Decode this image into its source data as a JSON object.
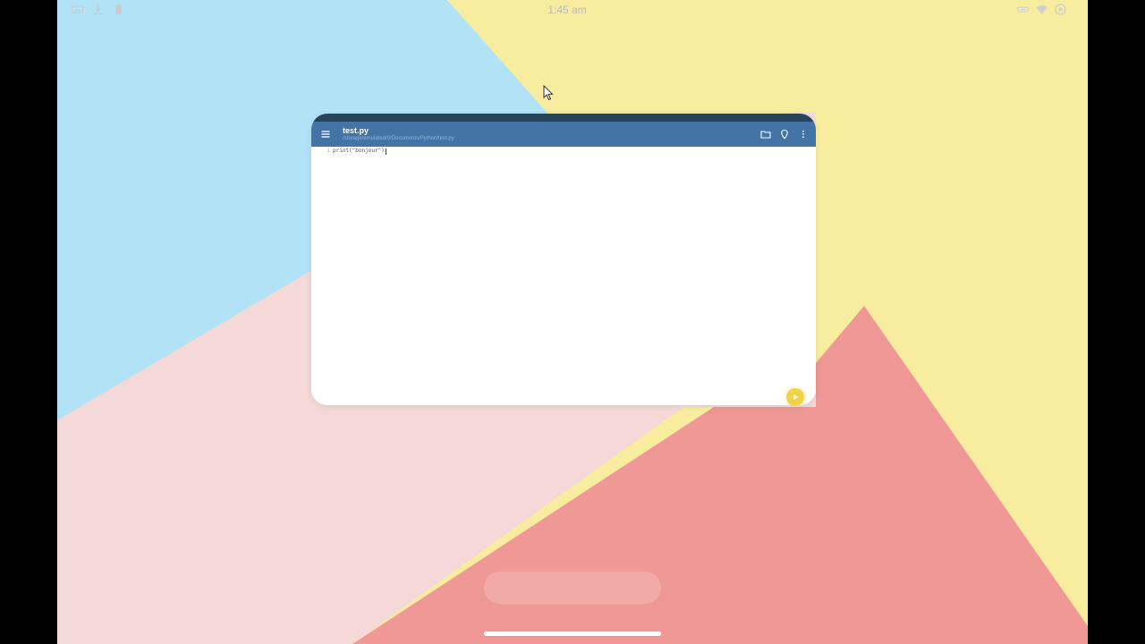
{
  "status_bar": {
    "time": "1:45 am",
    "left_icons": [
      "keyboard-icon",
      "download-icon",
      "battery-icon"
    ],
    "right_icons": [
      "link-icon",
      "wifi-icon",
      "settings-icon"
    ]
  },
  "wallpaper": {
    "colors": {
      "blue": "#b2e2f6",
      "yellow": "#f8ec9e",
      "pink": "#f4d9d8",
      "coral": "#ef9895"
    }
  },
  "app": {
    "toolbar_color": "#4474a5",
    "handle_color": "#27455a",
    "file_title": "test.py",
    "file_path": "/storage/emulated/0/Documents/Python/test.py",
    "toolbar_icons": [
      "menu-icon",
      "folder-icon",
      "location-pin-icon",
      "more-vert-icon"
    ],
    "editor": {
      "lines": [
        {
          "number": "1",
          "text": "print(\"bonjour\")"
        }
      ]
    },
    "run_button_color": "#f2d24a"
  }
}
